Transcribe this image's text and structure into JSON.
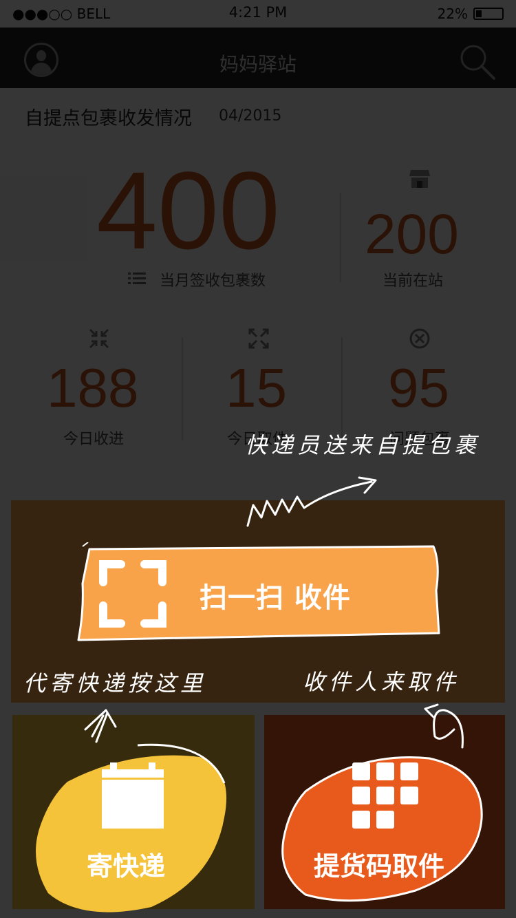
{
  "status_bar": {
    "carrier": "●●●○○ BELL",
    "time": "4:21 PM",
    "battery": "22%"
  },
  "nav": {
    "title": "妈妈驿站",
    "left_icon": "user-avatar-icon",
    "right_icon": "search-icon"
  },
  "stats": {
    "section_title": "自提点包裹收发情况",
    "date": "04/2015",
    "month_signed": {
      "value": "400",
      "label": "当月签收包裹数"
    },
    "in_station": {
      "value": "200",
      "label": "当前在站"
    },
    "today_in": {
      "value": "188",
      "label": "今日收进"
    },
    "today_out": {
      "value": "15",
      "label": "今日取件"
    },
    "problem": {
      "value": "95",
      "label": "问题包裹"
    }
  },
  "tiles": {
    "scan": {
      "label": "扫一扫 收件"
    },
    "send": {
      "label": "寄快递"
    },
    "pick": {
      "label": "提货码取件"
    }
  },
  "guide": {
    "note_top": "快递员送来自提包裹",
    "note_left": "代寄快递按这里",
    "note_right": "收件人来取件"
  },
  "colors": {
    "accent": "#f8a34a",
    "yellow": "#f5c33a",
    "orange": "#e85a1c",
    "number": "#c4521f"
  }
}
